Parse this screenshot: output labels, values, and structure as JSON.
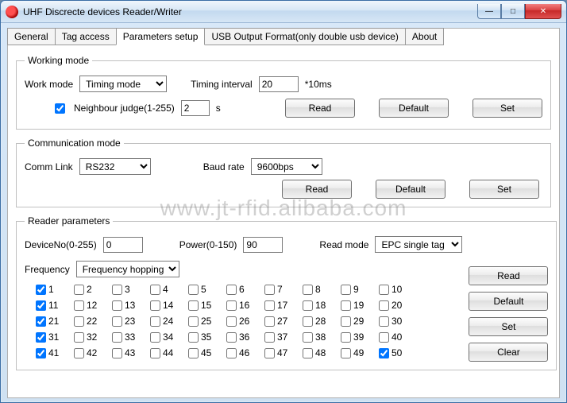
{
  "window": {
    "title": "UHF Discrecte devices Reader/Writer"
  },
  "tabs": {
    "general": "General",
    "tagaccess": "Tag access",
    "params": "Parameters setup",
    "usb": "USB Output Format(only double usb device)",
    "about": "About"
  },
  "working_mode": {
    "legend": "Working mode",
    "work_mode_label": "Work mode",
    "work_mode_value": "Timing mode",
    "timing_interval_label": "Timing interval",
    "timing_interval_value": "20",
    "timing_interval_suffix": "*10ms",
    "neighbour_label": "Neighbour judge(1-255)",
    "neighbour_value": "2",
    "neighbour_suffix": "s",
    "neighbour_checked": true,
    "btn_read": "Read",
    "btn_default": "Default",
    "btn_set": "Set"
  },
  "comm_mode": {
    "legend": "Communication mode",
    "comm_link_label": "Comm Link",
    "comm_link_value": "RS232",
    "baud_label": "Baud rate",
    "baud_value": "9600bps",
    "btn_read": "Read",
    "btn_default": "Default",
    "btn_set": "Set"
  },
  "reader_params": {
    "legend": "Reader parameters",
    "deviceno_label": "DeviceNo(0-255)",
    "deviceno_value": "0",
    "power_label": "Power(0-150)",
    "power_value": "90",
    "readmode_label": "Read mode",
    "readmode_value": "EPC single tag",
    "frequency_label": "Frequency",
    "frequency_value": "Frequency hopping",
    "btn_read": "Read",
    "btn_default": "Default",
    "btn_set": "Set",
    "btn_clear": "Clear",
    "freq_count": 50,
    "freq_checked": [
      1,
      11,
      21,
      31,
      41,
      50
    ]
  },
  "watermark": "www.jt-rfid.alibaba.com"
}
